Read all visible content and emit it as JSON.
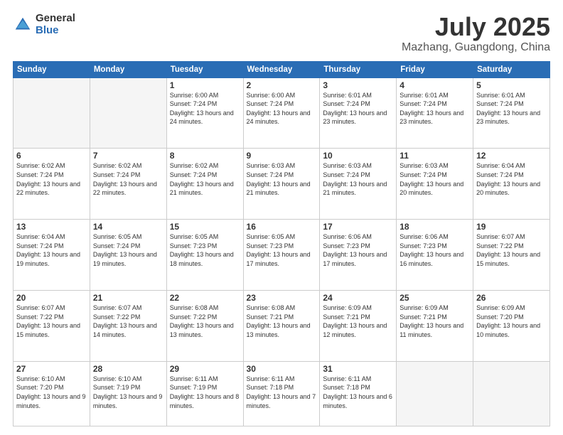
{
  "logo": {
    "general": "General",
    "blue": "Blue"
  },
  "header": {
    "month": "July 2025",
    "location": "Mazhang, Guangdong, China"
  },
  "weekdays": [
    "Sunday",
    "Monday",
    "Tuesday",
    "Wednesday",
    "Thursday",
    "Friday",
    "Saturday"
  ],
  "weeks": [
    [
      {
        "day": "",
        "sunrise": "",
        "sunset": "",
        "daylight": ""
      },
      {
        "day": "",
        "sunrise": "",
        "sunset": "",
        "daylight": ""
      },
      {
        "day": "1",
        "sunrise": "Sunrise: 6:00 AM",
        "sunset": "Sunset: 7:24 PM",
        "daylight": "Daylight: 13 hours and 24 minutes."
      },
      {
        "day": "2",
        "sunrise": "Sunrise: 6:00 AM",
        "sunset": "Sunset: 7:24 PM",
        "daylight": "Daylight: 13 hours and 24 minutes."
      },
      {
        "day": "3",
        "sunrise": "Sunrise: 6:01 AM",
        "sunset": "Sunset: 7:24 PM",
        "daylight": "Daylight: 13 hours and 23 minutes."
      },
      {
        "day": "4",
        "sunrise": "Sunrise: 6:01 AM",
        "sunset": "Sunset: 7:24 PM",
        "daylight": "Daylight: 13 hours and 23 minutes."
      },
      {
        "day": "5",
        "sunrise": "Sunrise: 6:01 AM",
        "sunset": "Sunset: 7:24 PM",
        "daylight": "Daylight: 13 hours and 23 minutes."
      }
    ],
    [
      {
        "day": "6",
        "sunrise": "Sunrise: 6:02 AM",
        "sunset": "Sunset: 7:24 PM",
        "daylight": "Daylight: 13 hours and 22 minutes."
      },
      {
        "day": "7",
        "sunrise": "Sunrise: 6:02 AM",
        "sunset": "Sunset: 7:24 PM",
        "daylight": "Daylight: 13 hours and 22 minutes."
      },
      {
        "day": "8",
        "sunrise": "Sunrise: 6:02 AM",
        "sunset": "Sunset: 7:24 PM",
        "daylight": "Daylight: 13 hours and 21 minutes."
      },
      {
        "day": "9",
        "sunrise": "Sunrise: 6:03 AM",
        "sunset": "Sunset: 7:24 PM",
        "daylight": "Daylight: 13 hours and 21 minutes."
      },
      {
        "day": "10",
        "sunrise": "Sunrise: 6:03 AM",
        "sunset": "Sunset: 7:24 PM",
        "daylight": "Daylight: 13 hours and 21 minutes."
      },
      {
        "day": "11",
        "sunrise": "Sunrise: 6:03 AM",
        "sunset": "Sunset: 7:24 PM",
        "daylight": "Daylight: 13 hours and 20 minutes."
      },
      {
        "day": "12",
        "sunrise": "Sunrise: 6:04 AM",
        "sunset": "Sunset: 7:24 PM",
        "daylight": "Daylight: 13 hours and 20 minutes."
      }
    ],
    [
      {
        "day": "13",
        "sunrise": "Sunrise: 6:04 AM",
        "sunset": "Sunset: 7:24 PM",
        "daylight": "Daylight: 13 hours and 19 minutes."
      },
      {
        "day": "14",
        "sunrise": "Sunrise: 6:05 AM",
        "sunset": "Sunset: 7:24 PM",
        "daylight": "Daylight: 13 hours and 19 minutes."
      },
      {
        "day": "15",
        "sunrise": "Sunrise: 6:05 AM",
        "sunset": "Sunset: 7:23 PM",
        "daylight": "Daylight: 13 hours and 18 minutes."
      },
      {
        "day": "16",
        "sunrise": "Sunrise: 6:05 AM",
        "sunset": "Sunset: 7:23 PM",
        "daylight": "Daylight: 13 hours and 17 minutes."
      },
      {
        "day": "17",
        "sunrise": "Sunrise: 6:06 AM",
        "sunset": "Sunset: 7:23 PM",
        "daylight": "Daylight: 13 hours and 17 minutes."
      },
      {
        "day": "18",
        "sunrise": "Sunrise: 6:06 AM",
        "sunset": "Sunset: 7:23 PM",
        "daylight": "Daylight: 13 hours and 16 minutes."
      },
      {
        "day": "19",
        "sunrise": "Sunrise: 6:07 AM",
        "sunset": "Sunset: 7:22 PM",
        "daylight": "Daylight: 13 hours and 15 minutes."
      }
    ],
    [
      {
        "day": "20",
        "sunrise": "Sunrise: 6:07 AM",
        "sunset": "Sunset: 7:22 PM",
        "daylight": "Daylight: 13 hours and 15 minutes."
      },
      {
        "day": "21",
        "sunrise": "Sunrise: 6:07 AM",
        "sunset": "Sunset: 7:22 PM",
        "daylight": "Daylight: 13 hours and 14 minutes."
      },
      {
        "day": "22",
        "sunrise": "Sunrise: 6:08 AM",
        "sunset": "Sunset: 7:22 PM",
        "daylight": "Daylight: 13 hours and 13 minutes."
      },
      {
        "day": "23",
        "sunrise": "Sunrise: 6:08 AM",
        "sunset": "Sunset: 7:21 PM",
        "daylight": "Daylight: 13 hours and 13 minutes."
      },
      {
        "day": "24",
        "sunrise": "Sunrise: 6:09 AM",
        "sunset": "Sunset: 7:21 PM",
        "daylight": "Daylight: 13 hours and 12 minutes."
      },
      {
        "day": "25",
        "sunrise": "Sunrise: 6:09 AM",
        "sunset": "Sunset: 7:21 PM",
        "daylight": "Daylight: 13 hours and 11 minutes."
      },
      {
        "day": "26",
        "sunrise": "Sunrise: 6:09 AM",
        "sunset": "Sunset: 7:20 PM",
        "daylight": "Daylight: 13 hours and 10 minutes."
      }
    ],
    [
      {
        "day": "27",
        "sunrise": "Sunrise: 6:10 AM",
        "sunset": "Sunset: 7:20 PM",
        "daylight": "Daylight: 13 hours and 9 minutes."
      },
      {
        "day": "28",
        "sunrise": "Sunrise: 6:10 AM",
        "sunset": "Sunset: 7:19 PM",
        "daylight": "Daylight: 13 hours and 9 minutes."
      },
      {
        "day": "29",
        "sunrise": "Sunrise: 6:11 AM",
        "sunset": "Sunset: 7:19 PM",
        "daylight": "Daylight: 13 hours and 8 minutes."
      },
      {
        "day": "30",
        "sunrise": "Sunrise: 6:11 AM",
        "sunset": "Sunset: 7:18 PM",
        "daylight": "Daylight: 13 hours and 7 minutes."
      },
      {
        "day": "31",
        "sunrise": "Sunrise: 6:11 AM",
        "sunset": "Sunset: 7:18 PM",
        "daylight": "Daylight: 13 hours and 6 minutes."
      },
      {
        "day": "",
        "sunrise": "",
        "sunset": "",
        "daylight": ""
      },
      {
        "day": "",
        "sunrise": "",
        "sunset": "",
        "daylight": ""
      }
    ]
  ]
}
